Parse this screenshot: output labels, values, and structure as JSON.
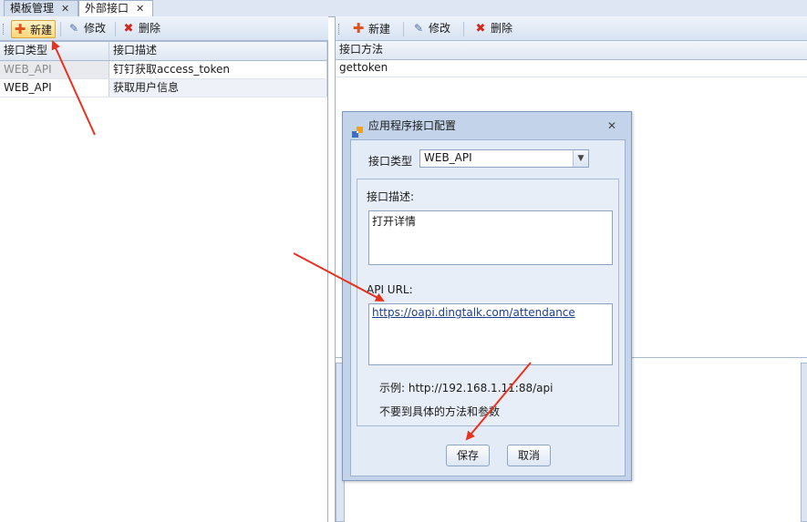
{
  "tabs": [
    {
      "label": "模板管理",
      "active": false
    },
    {
      "label": "外部接口",
      "active": true
    }
  ],
  "left_toolbar": {
    "new_label": "新建",
    "edit_label": "修改",
    "delete_label": "删除"
  },
  "left_grid": {
    "columns": [
      "接口类型",
      "接口描述"
    ],
    "rows": [
      {
        "type": "WEB_API",
        "desc": "钉钉获取access_token"
      },
      {
        "type": "WEB_API",
        "desc": "获取用户信息"
      }
    ]
  },
  "right_toolbar": {
    "new_label": "新建",
    "edit_label": "修改",
    "delete_label": "删除"
  },
  "right_grid": {
    "columns": [
      "接口方法"
    ],
    "rows": [
      "gettoken"
    ]
  },
  "dialog": {
    "title": "应用程序接口配置",
    "type_label": "接口类型",
    "type_value": "WEB_API",
    "desc_label": "接口描述:",
    "desc_value": "打开详情",
    "url_label": "API URL:",
    "url_value": "https://oapi.dingtalk.com/attendance",
    "example_text": "示例: http://192.168.1.11:88/api",
    "note_text": "不要到具体的方法和参数",
    "save_label": "保存",
    "cancel_label": "取消"
  },
  "colors": {
    "accent_arrow": "#e8321e",
    "highlight_button": "#ffd77a"
  }
}
